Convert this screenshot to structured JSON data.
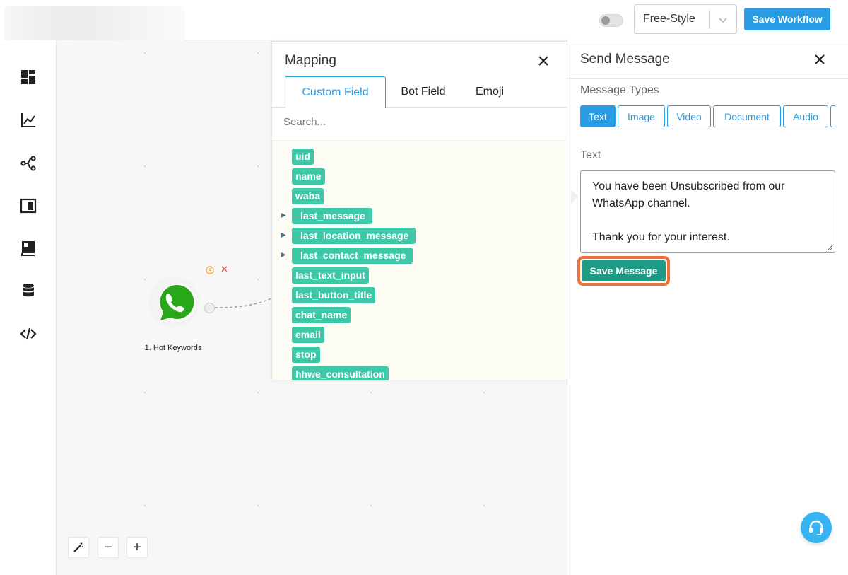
{
  "topbar": {
    "mode_select_value": "Free-Style",
    "save_workflow_label": "Save Workflow"
  },
  "sidebar": {
    "icons": [
      "dashboard-icon",
      "analytics-icon",
      "share-flow-icon",
      "template-icon",
      "book-icon",
      "database-icon",
      "code-icon"
    ]
  },
  "canvas": {
    "node": {
      "label": "1. Hot Keywords",
      "icon": "whatsapp-icon"
    },
    "controls": [
      "magic-wand-icon",
      "−",
      "+"
    ]
  },
  "mapping": {
    "title": "Mapping",
    "tabs": [
      "Custom Field",
      "Bot Field",
      "Emoji"
    ],
    "active_tab": "Custom Field",
    "search_placeholder": "Search...",
    "fields": [
      {
        "name": "uid",
        "expandable": false
      },
      {
        "name": "name",
        "expandable": false
      },
      {
        "name": "waba",
        "expandable": false
      },
      {
        "name": "last_message",
        "expandable": true
      },
      {
        "name": "last_location_message",
        "expandable": true
      },
      {
        "name": "last_contact_message",
        "expandable": true
      },
      {
        "name": "last_text_input",
        "expandable": false
      },
      {
        "name": "last_button_title",
        "expandable": false
      },
      {
        "name": "chat_name",
        "expandable": false
      },
      {
        "name": "email",
        "expandable": false
      },
      {
        "name": "stop",
        "expandable": false
      },
      {
        "name": "hhwe_consultation",
        "expandable": false
      }
    ],
    "tag_color": "#3ec8a8"
  },
  "send_message": {
    "title": "Send Message",
    "message_types_label": "Message Types",
    "message_types": [
      "Text",
      "Image",
      "Video",
      "Document",
      "Audio"
    ],
    "active_type": "Text",
    "text_label": "Text",
    "text_value": "You have been Unsubscribed from our WhatsApp channel.\n\nThank you for your interest.",
    "save_message_label": "Save Message"
  },
  "colors": {
    "accent": "#2a9ce3",
    "save_message": "#1e9b86",
    "highlight_ring": "#f0703a",
    "help_button": "#36b5f2"
  }
}
